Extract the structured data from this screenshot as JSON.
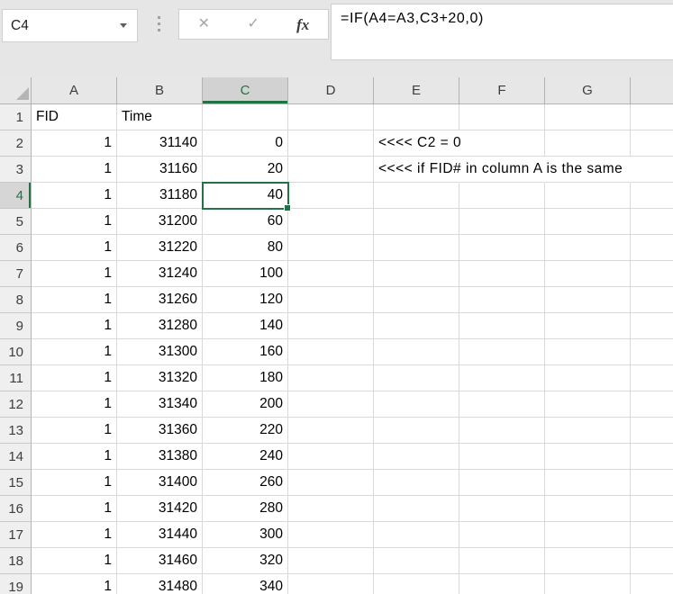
{
  "name_box": {
    "value": "C4"
  },
  "formula_bar": {
    "formula": "=IF(A4=A3,C3+20,0)",
    "cancel_label": "✕",
    "enter_label": "✓",
    "fx_label": "fx"
  },
  "colors": {
    "excel_green": "#217346",
    "toolbar_bg": "#e6e6e6",
    "header_bg": "#e7e7e7",
    "selected_header_bg": "#d2d2d2",
    "gridline": "#d9d9d9"
  },
  "grid": {
    "column_headers": [
      "A",
      "B",
      "C",
      "D",
      "E",
      "F",
      "G"
    ],
    "selected_cell": "C4",
    "selected_column": "C",
    "selected_row": 4,
    "rows": [
      {
        "n": 1,
        "A": "FID",
        "B": "Time"
      },
      {
        "n": 2,
        "A": "1",
        "B": "31140",
        "C": "0",
        "E": "<<<< C2 = 0"
      },
      {
        "n": 3,
        "A": "1",
        "B": "31160",
        "C": "20",
        "E": "<<<< if FID# in column A is the same"
      },
      {
        "n": 4,
        "A": "1",
        "B": "31180",
        "C": "40"
      },
      {
        "n": 5,
        "A": "1",
        "B": "31200",
        "C": "60"
      },
      {
        "n": 6,
        "A": "1",
        "B": "31220",
        "C": "80"
      },
      {
        "n": 7,
        "A": "1",
        "B": "31240",
        "C": "100"
      },
      {
        "n": 8,
        "A": "1",
        "B": "31260",
        "C": "120"
      },
      {
        "n": 9,
        "A": "1",
        "B": "31280",
        "C": "140"
      },
      {
        "n": 10,
        "A": "1",
        "B": "31300",
        "C": "160"
      },
      {
        "n": 11,
        "A": "1",
        "B": "31320",
        "C": "180"
      },
      {
        "n": 12,
        "A": "1",
        "B": "31340",
        "C": "200"
      },
      {
        "n": 13,
        "A": "1",
        "B": "31360",
        "C": "220"
      },
      {
        "n": 14,
        "A": "1",
        "B": "31380",
        "C": "240"
      },
      {
        "n": 15,
        "A": "1",
        "B": "31400",
        "C": "260"
      },
      {
        "n": 16,
        "A": "1",
        "B": "31420",
        "C": "280"
      },
      {
        "n": 17,
        "A": "1",
        "B": "31440",
        "C": "300"
      },
      {
        "n": 18,
        "A": "1",
        "B": "31460",
        "C": "320"
      },
      {
        "n": 19,
        "A": "1",
        "B": "31480",
        "C": "340"
      }
    ]
  }
}
